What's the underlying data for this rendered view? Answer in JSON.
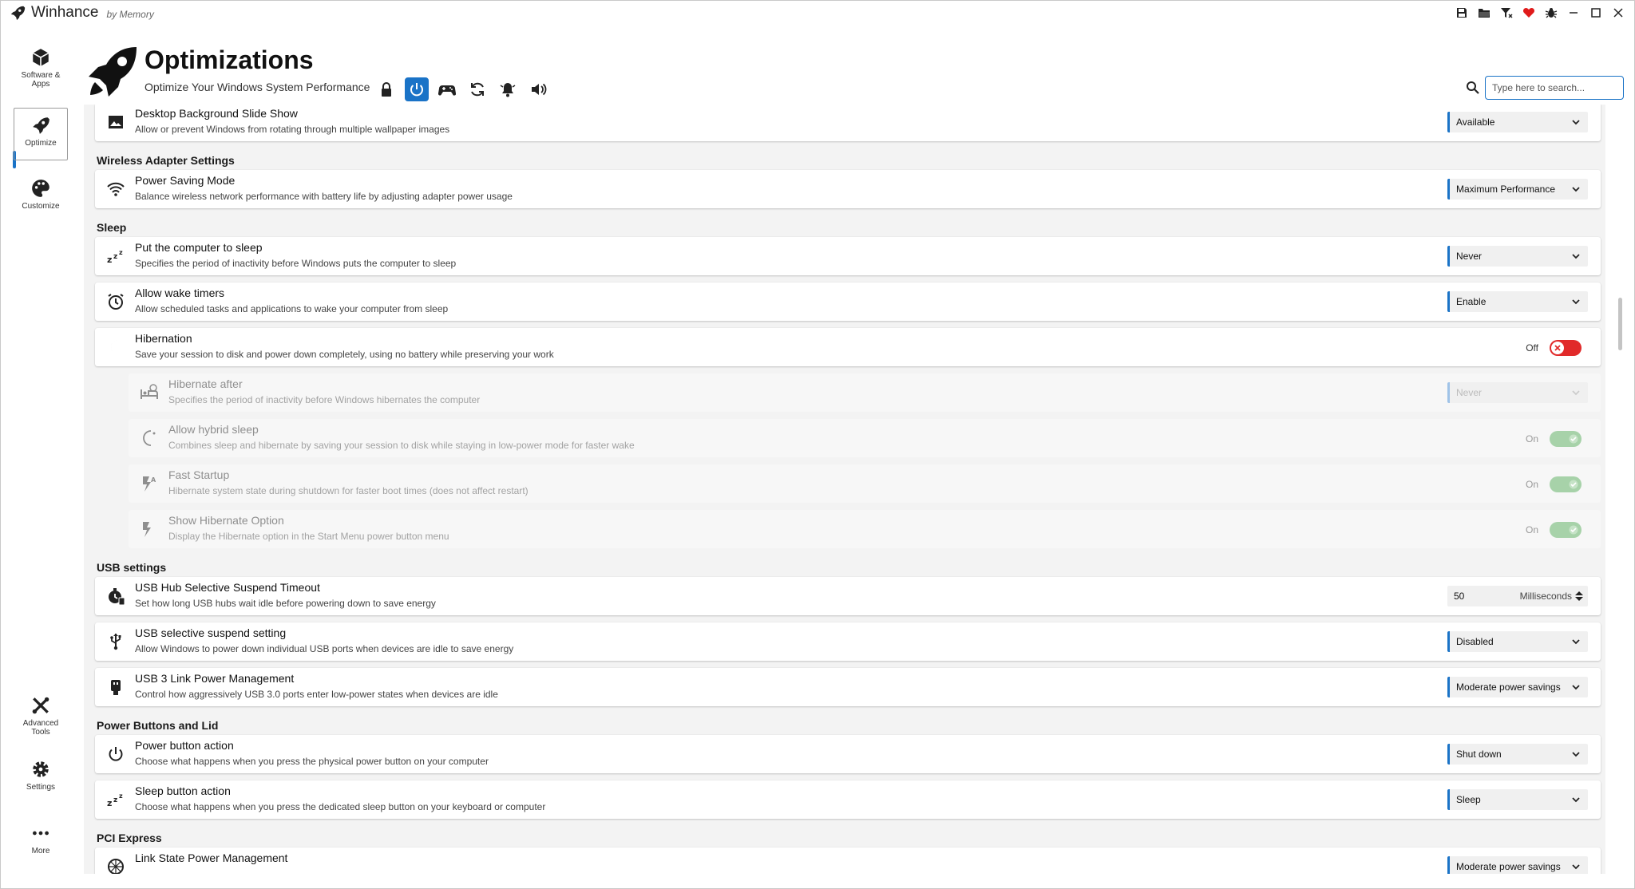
{
  "titlebar": {
    "app_name": "Winhance",
    "app_sub": "by Memory"
  },
  "sidebar": {
    "items": [
      {
        "label": "Software & Apps"
      },
      {
        "label": "Optimize"
      },
      {
        "label": "Customize"
      },
      {
        "label": "Advanced Tools"
      },
      {
        "label": "Settings"
      },
      {
        "label": "More"
      }
    ]
  },
  "header": {
    "title": "Optimizations",
    "subtitle": "Optimize Your Windows System Performance",
    "search_placeholder": "Type here to search..."
  },
  "sections": {
    "wireless": "Wireless Adapter Settings",
    "sleep": "Sleep",
    "usb": "USB settings",
    "power_buttons": "Power Buttons and Lid",
    "pci": "PCI Express"
  },
  "settings": {
    "slideshow": {
      "title": "Desktop Background Slide Show",
      "desc": "Allow or prevent Windows from rotating through multiple wallpaper images",
      "value": "Available"
    },
    "wifi_power": {
      "title": "Power Saving Mode",
      "desc": "Balance wireless network performance with battery life by adjusting adapter power usage",
      "value": "Maximum Performance"
    },
    "sleep_after": {
      "title": "Put the computer to sleep",
      "desc": "Specifies the period of inactivity before Windows puts the computer to sleep",
      "value": "Never"
    },
    "wake_timers": {
      "title": "Allow wake timers",
      "desc": "Allow scheduled tasks and applications to wake your computer from sleep",
      "value": "Enable"
    },
    "hibernation": {
      "title": "Hibernation",
      "desc": "Save your session to disk and power down completely, using no battery while preserving your work",
      "state": "Off"
    },
    "hibernate_after": {
      "title": "Hibernate after",
      "desc": "Specifies the period of inactivity before Windows hibernates the computer",
      "value": "Never"
    },
    "hybrid_sleep": {
      "title": "Allow hybrid sleep",
      "desc": "Combines sleep and hibernate by saving your session to disk while staying in low-power mode for faster wake",
      "state": "On"
    },
    "fast_startup": {
      "title": "Fast Startup",
      "desc": "Hibernate system state during shutdown for faster boot times (does not affect restart)",
      "state": "On"
    },
    "show_hibernate": {
      "title": "Show Hibernate Option",
      "desc": "Display the Hibernate option in the Start Menu power button menu",
      "state": "On"
    },
    "usb_hub_timeout": {
      "title": "USB Hub Selective Suspend Timeout",
      "desc": "Set how long USB hubs wait idle before powering down to save energy",
      "value": "50",
      "unit": "Milliseconds"
    },
    "usb_selective": {
      "title": "USB selective suspend setting",
      "desc": "Allow Windows to power down individual USB ports when devices are idle to save energy",
      "value": "Disabled"
    },
    "usb3_link": {
      "title": "USB 3 Link Power Management",
      "desc": "Control how aggressively USB 3.0 ports enter low-power states when devices are idle",
      "value": "Moderate power savings"
    },
    "power_button": {
      "title": "Power button action",
      "desc": "Choose what happens when you press the physical power button on your computer",
      "value": "Shut down"
    },
    "sleep_button": {
      "title": "Sleep button action",
      "desc": "Choose what happens when you press the dedicated sleep button on your keyboard or computer",
      "value": "Sleep"
    },
    "link_state": {
      "title": "Link State Power Management",
      "desc": "",
      "value": "Moderate power savings"
    }
  },
  "colors": {
    "accent": "#1a73c7",
    "toggle_off": "#e12a2a",
    "toggle_on": "#a7d2a9"
  }
}
